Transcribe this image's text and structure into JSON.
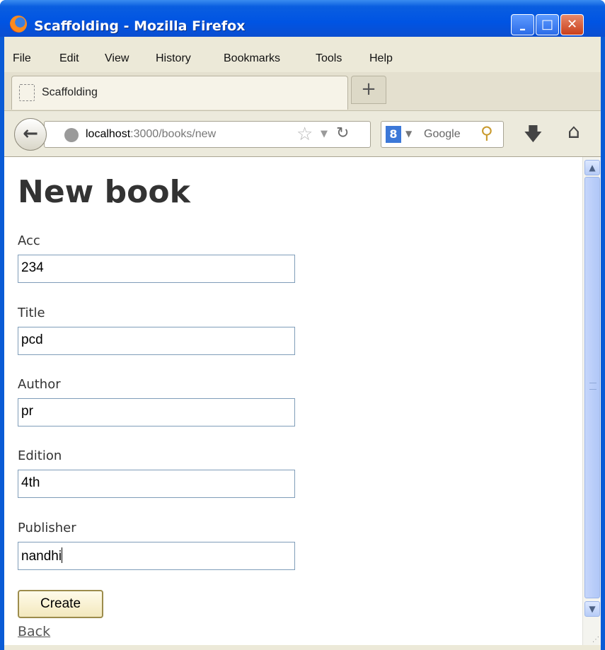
{
  "window": {
    "title": "Scaffolding - Mozilla Firefox",
    "controls": {
      "minimize": "–",
      "maximize": "□",
      "close": "✕"
    }
  },
  "menubar": {
    "items": [
      "File",
      "Edit",
      "View",
      "History",
      "Bookmarks",
      "Tools",
      "Help"
    ]
  },
  "tabs": {
    "active_tab": {
      "label": "Scaffolding"
    },
    "new_tab_label": "+"
  },
  "navbar": {
    "url_host": "localhost",
    "url_path": ":3000/books/new",
    "search": {
      "engine": "8",
      "placeholder": "Google"
    }
  },
  "form": {
    "heading": "New book",
    "fields": [
      {
        "label": "Acc",
        "value": "234"
      },
      {
        "label": "Title",
        "value": "pcd"
      },
      {
        "label": "Author",
        "value": "pr"
      },
      {
        "label": "Edition",
        "value": "4th"
      },
      {
        "label": "Publisher",
        "value": "nandhi"
      }
    ],
    "submit_label": "Create",
    "back_label": "Back"
  },
  "colors": {
    "titlebar": "#0054e3",
    "chrome": "#ece9d8",
    "input_border": "#7f9db9",
    "button_border": "#9c8c4c"
  }
}
